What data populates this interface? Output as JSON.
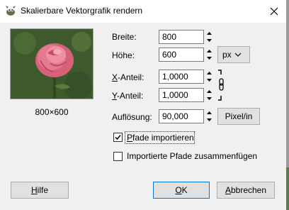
{
  "window": {
    "title": "Skalierbare Vektorgrafik rendern",
    "close_icon": "close-icon",
    "app_icon": "gimp-wilber-icon"
  },
  "preview": {
    "size_text": "800×600"
  },
  "fields": {
    "width_label": "Breite:",
    "width_value": "800",
    "height_label": "Höhe:",
    "height_value": "600",
    "unit_value": "px",
    "x_ratio_label_u": "X",
    "x_ratio_label_rest": "-Anteil:",
    "x_ratio_value": "1,0000",
    "y_ratio_label_u": "Y",
    "y_ratio_label_rest": "-Anteil:",
    "y_ratio_value": "1,0000",
    "resolution_label": "Auflösung:",
    "resolution_value": "90,000",
    "resolution_unit": "Pixel/in"
  },
  "options": {
    "import_paths_u": "P",
    "import_paths_rest": "fade importieren",
    "import_paths_checked": true,
    "merge_paths_label": "Importierte Pfade zusammenfügen",
    "merge_paths_checked": false
  },
  "buttons": {
    "help_u": "H",
    "help_rest": "ilfe",
    "ok_u": "O",
    "ok_rest": "K",
    "cancel_u": "A",
    "cancel_rest": "bbrechen"
  }
}
